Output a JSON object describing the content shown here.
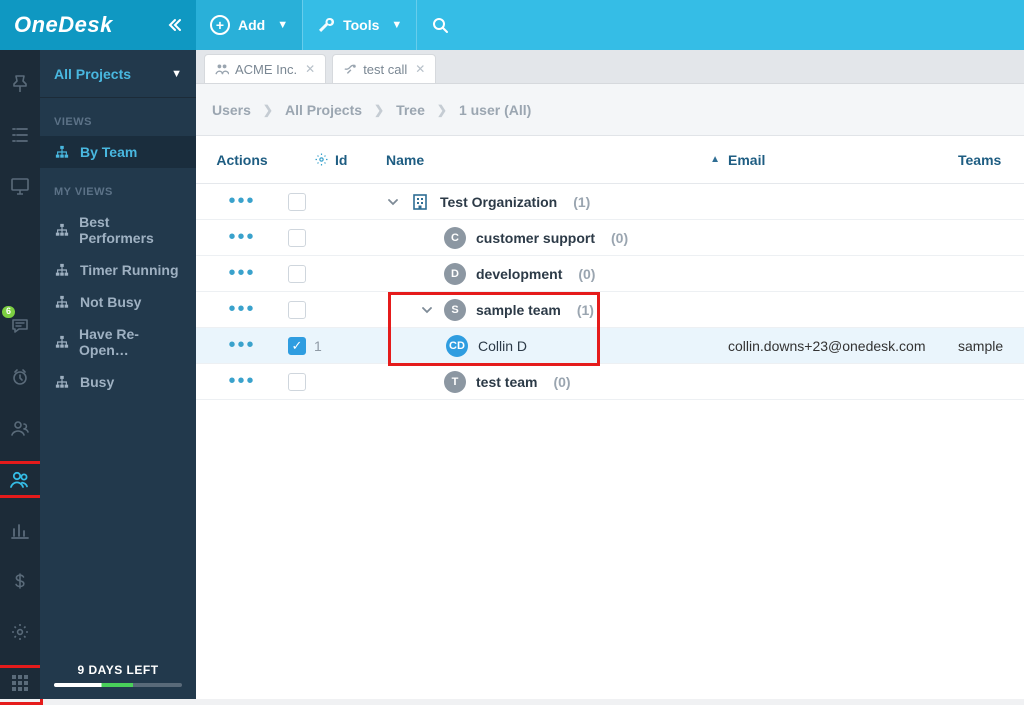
{
  "app": {
    "name": "OneDesk"
  },
  "toolbar": {
    "add_label": "Add",
    "tools_label": "Tools"
  },
  "sidebar": {
    "project_selector": "All Projects",
    "views_label": "VIEWS",
    "myviews_label": "MY VIEWS",
    "views": [
      {
        "label": "By Team",
        "active": true
      }
    ],
    "my_views": [
      {
        "label": "Best Performers"
      },
      {
        "label": "Timer Running"
      },
      {
        "label": "Not Busy"
      },
      {
        "label": "Have Re-Open…"
      },
      {
        "label": "Busy"
      }
    ],
    "trial_text": "9 DAYS LEFT"
  },
  "rail": {
    "badge_count": "6"
  },
  "tabs": [
    {
      "label": "ACME Inc."
    },
    {
      "label": "test call"
    }
  ],
  "breadcrumbs": [
    "Users",
    "All Projects",
    "Tree",
    "1 user (All)"
  ],
  "columns": {
    "actions": "Actions",
    "id": "Id",
    "name": "Name",
    "email": "Email",
    "teams": "Teams"
  },
  "rows": [
    {
      "type": "org",
      "indent": 0,
      "expand": "open",
      "name": "Test Organization",
      "count": "(1)",
      "checked": false
    },
    {
      "type": "team",
      "indent": 1,
      "initial": "C",
      "name": "customer support",
      "count": "(0)",
      "checked": false
    },
    {
      "type": "team",
      "indent": 1,
      "initial": "D",
      "name": "development",
      "count": "(0)",
      "checked": false
    },
    {
      "type": "team",
      "indent": 1,
      "expand": "open",
      "initial": "S",
      "name": "sample team",
      "count": "(1)",
      "checked": false
    },
    {
      "type": "user",
      "indent": 2,
      "id": "1",
      "initial": "CD",
      "name": "Collin D",
      "email": "collin.downs+23@onedesk.com",
      "teams": "sample",
      "checked": true
    },
    {
      "type": "team",
      "indent": 1,
      "initial": "T",
      "name": "test team",
      "count": "(0)",
      "checked": false
    }
  ]
}
